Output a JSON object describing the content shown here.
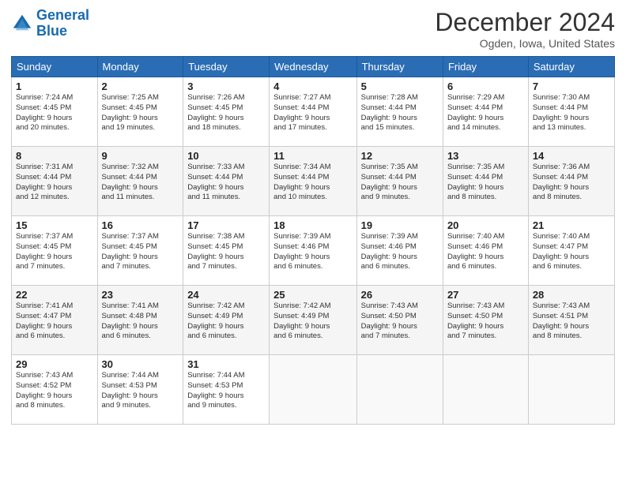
{
  "logo": {
    "line1": "General",
    "line2": "Blue"
  },
  "header": {
    "month": "December 2024",
    "location": "Ogden, Iowa, United States"
  },
  "weekdays": [
    "Sunday",
    "Monday",
    "Tuesday",
    "Wednesday",
    "Thursday",
    "Friday",
    "Saturday"
  ],
  "weeks": [
    [
      {
        "day": "1",
        "info": "Sunrise: 7:24 AM\nSunset: 4:45 PM\nDaylight: 9 hours\nand 20 minutes."
      },
      {
        "day": "2",
        "info": "Sunrise: 7:25 AM\nSunset: 4:45 PM\nDaylight: 9 hours\nand 19 minutes."
      },
      {
        "day": "3",
        "info": "Sunrise: 7:26 AM\nSunset: 4:45 PM\nDaylight: 9 hours\nand 18 minutes."
      },
      {
        "day": "4",
        "info": "Sunrise: 7:27 AM\nSunset: 4:44 PM\nDaylight: 9 hours\nand 17 minutes."
      },
      {
        "day": "5",
        "info": "Sunrise: 7:28 AM\nSunset: 4:44 PM\nDaylight: 9 hours\nand 15 minutes."
      },
      {
        "day": "6",
        "info": "Sunrise: 7:29 AM\nSunset: 4:44 PM\nDaylight: 9 hours\nand 14 minutes."
      },
      {
        "day": "7",
        "info": "Sunrise: 7:30 AM\nSunset: 4:44 PM\nDaylight: 9 hours\nand 13 minutes."
      }
    ],
    [
      {
        "day": "8",
        "info": "Sunrise: 7:31 AM\nSunset: 4:44 PM\nDaylight: 9 hours\nand 12 minutes."
      },
      {
        "day": "9",
        "info": "Sunrise: 7:32 AM\nSunset: 4:44 PM\nDaylight: 9 hours\nand 11 minutes."
      },
      {
        "day": "10",
        "info": "Sunrise: 7:33 AM\nSunset: 4:44 PM\nDaylight: 9 hours\nand 11 minutes."
      },
      {
        "day": "11",
        "info": "Sunrise: 7:34 AM\nSunset: 4:44 PM\nDaylight: 9 hours\nand 10 minutes."
      },
      {
        "day": "12",
        "info": "Sunrise: 7:35 AM\nSunset: 4:44 PM\nDaylight: 9 hours\nand 9 minutes."
      },
      {
        "day": "13",
        "info": "Sunrise: 7:35 AM\nSunset: 4:44 PM\nDaylight: 9 hours\nand 8 minutes."
      },
      {
        "day": "14",
        "info": "Sunrise: 7:36 AM\nSunset: 4:44 PM\nDaylight: 9 hours\nand 8 minutes."
      }
    ],
    [
      {
        "day": "15",
        "info": "Sunrise: 7:37 AM\nSunset: 4:45 PM\nDaylight: 9 hours\nand 7 minutes."
      },
      {
        "day": "16",
        "info": "Sunrise: 7:37 AM\nSunset: 4:45 PM\nDaylight: 9 hours\nand 7 minutes."
      },
      {
        "day": "17",
        "info": "Sunrise: 7:38 AM\nSunset: 4:45 PM\nDaylight: 9 hours\nand 7 minutes."
      },
      {
        "day": "18",
        "info": "Sunrise: 7:39 AM\nSunset: 4:46 PM\nDaylight: 9 hours\nand 6 minutes."
      },
      {
        "day": "19",
        "info": "Sunrise: 7:39 AM\nSunset: 4:46 PM\nDaylight: 9 hours\nand 6 minutes."
      },
      {
        "day": "20",
        "info": "Sunrise: 7:40 AM\nSunset: 4:46 PM\nDaylight: 9 hours\nand 6 minutes."
      },
      {
        "day": "21",
        "info": "Sunrise: 7:40 AM\nSunset: 4:47 PM\nDaylight: 9 hours\nand 6 minutes."
      }
    ],
    [
      {
        "day": "22",
        "info": "Sunrise: 7:41 AM\nSunset: 4:47 PM\nDaylight: 9 hours\nand 6 minutes."
      },
      {
        "day": "23",
        "info": "Sunrise: 7:41 AM\nSunset: 4:48 PM\nDaylight: 9 hours\nand 6 minutes."
      },
      {
        "day": "24",
        "info": "Sunrise: 7:42 AM\nSunset: 4:49 PM\nDaylight: 9 hours\nand 6 minutes."
      },
      {
        "day": "25",
        "info": "Sunrise: 7:42 AM\nSunset: 4:49 PM\nDaylight: 9 hours\nand 6 minutes."
      },
      {
        "day": "26",
        "info": "Sunrise: 7:43 AM\nSunset: 4:50 PM\nDaylight: 9 hours\nand 7 minutes."
      },
      {
        "day": "27",
        "info": "Sunrise: 7:43 AM\nSunset: 4:50 PM\nDaylight: 9 hours\nand 7 minutes."
      },
      {
        "day": "28",
        "info": "Sunrise: 7:43 AM\nSunset: 4:51 PM\nDaylight: 9 hours\nand 8 minutes."
      }
    ],
    [
      {
        "day": "29",
        "info": "Sunrise: 7:43 AM\nSunset: 4:52 PM\nDaylight: 9 hours\nand 8 minutes."
      },
      {
        "day": "30",
        "info": "Sunrise: 7:44 AM\nSunset: 4:53 PM\nDaylight: 9 hours\nand 9 minutes."
      },
      {
        "day": "31",
        "info": "Sunrise: 7:44 AM\nSunset: 4:53 PM\nDaylight: 9 hours\nand 9 minutes."
      },
      null,
      null,
      null,
      null
    ]
  ]
}
